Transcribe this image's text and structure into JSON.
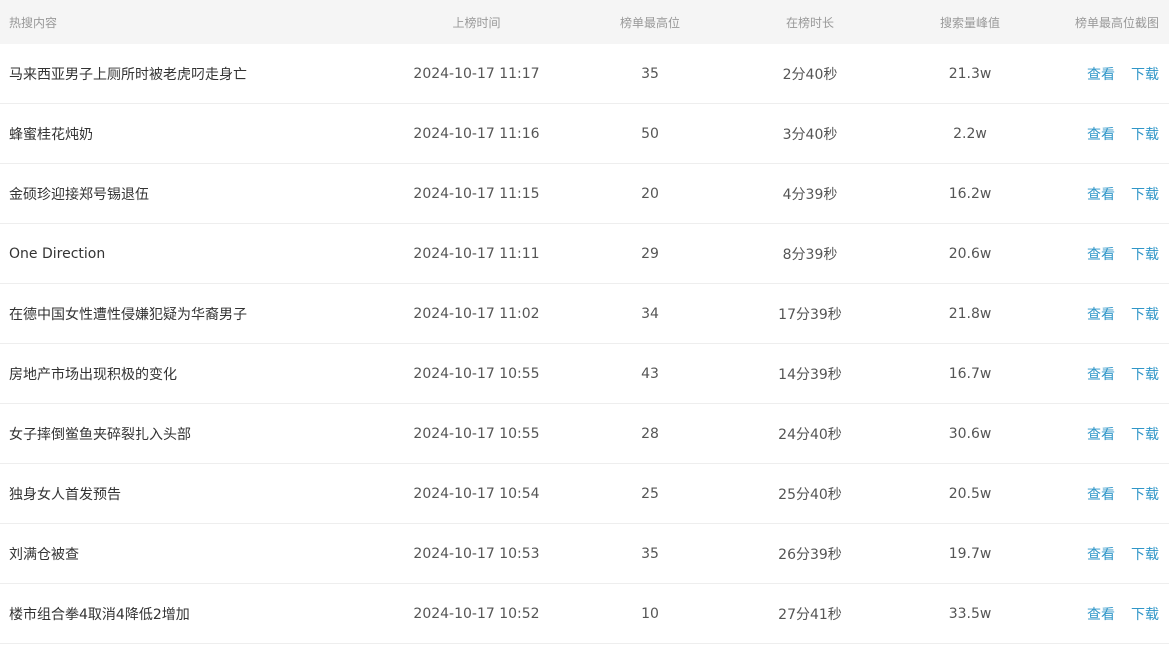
{
  "header": {
    "title": "热搜内容",
    "time": "上榜时间",
    "top_rank": "榜单最高位",
    "duration": "在榜时长",
    "peak": "搜索量峰值",
    "screenshot": "榜单最高位截图"
  },
  "actions": {
    "view": "查看",
    "download": "下载"
  },
  "colors": {
    "link": "#2f96c8",
    "header_bg": "#f5f5f5"
  },
  "rows": [
    {
      "title": "马来西亚男子上厕所时被老虎叼走身亡",
      "time": "2024-10-17 11:17",
      "rank": "35",
      "duration": "2分40秒",
      "peak": "21.3w"
    },
    {
      "title": "蜂蜜桂花炖奶",
      "time": "2024-10-17 11:16",
      "rank": "50",
      "duration": "3分40秒",
      "peak": "2.2w"
    },
    {
      "title": "金硕珍迎接郑号锡退伍",
      "time": "2024-10-17 11:15",
      "rank": "20",
      "duration": "4分39秒",
      "peak": "16.2w"
    },
    {
      "title": "One Direction",
      "time": "2024-10-17 11:11",
      "rank": "29",
      "duration": "8分39秒",
      "peak": "20.6w"
    },
    {
      "title": "在德中国女性遭性侵嫌犯疑为华裔男子",
      "time": "2024-10-17 11:02",
      "rank": "34",
      "duration": "17分39秒",
      "peak": "21.8w"
    },
    {
      "title": "房地产市场出现积极的变化",
      "time": "2024-10-17 10:55",
      "rank": "43",
      "duration": "14分39秒",
      "peak": "16.7w"
    },
    {
      "title": "女子摔倒鲎鱼夹碎裂扎入头部",
      "time": "2024-10-17 10:55",
      "rank": "28",
      "duration": "24分40秒",
      "peak": "30.6w"
    },
    {
      "title": "独身女人首发预告",
      "time": "2024-10-17 10:54",
      "rank": "25",
      "duration": "25分40秒",
      "peak": "20.5w"
    },
    {
      "title": "刘满仓被查",
      "time": "2024-10-17 10:53",
      "rank": "35",
      "duration": "26分39秒",
      "peak": "19.7w"
    },
    {
      "title": "楼市组合拳4取消4降低2增加",
      "time": "2024-10-17 10:52",
      "rank": "10",
      "duration": "27分41秒",
      "peak": "33.5w"
    }
  ]
}
